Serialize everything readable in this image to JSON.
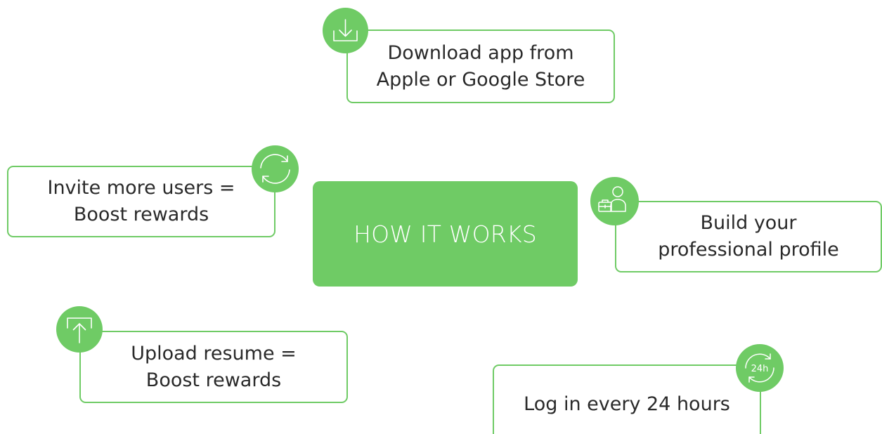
{
  "colors": {
    "accent": "#6fcb65",
    "text": "#2a2a2a",
    "background": "#ffffff"
  },
  "center": {
    "title": "HOW IT WORKS"
  },
  "steps": [
    {
      "icon": "download-icon",
      "line1": "Download app from",
      "line2": "Apple or Google Store"
    },
    {
      "icon": "refresh-icon",
      "line1": "Invite more users =",
      "line2": "Boost rewards"
    },
    {
      "icon": "profile-briefcase-icon",
      "line1": "Build your",
      "line2": "professional profile"
    },
    {
      "icon": "upload-icon",
      "line1": "Upload resume =",
      "line2": "Boost rewards"
    },
    {
      "icon": "clock-24h-icon",
      "line1": "Log in every 24 hours",
      "icon_text": "24h"
    }
  ]
}
